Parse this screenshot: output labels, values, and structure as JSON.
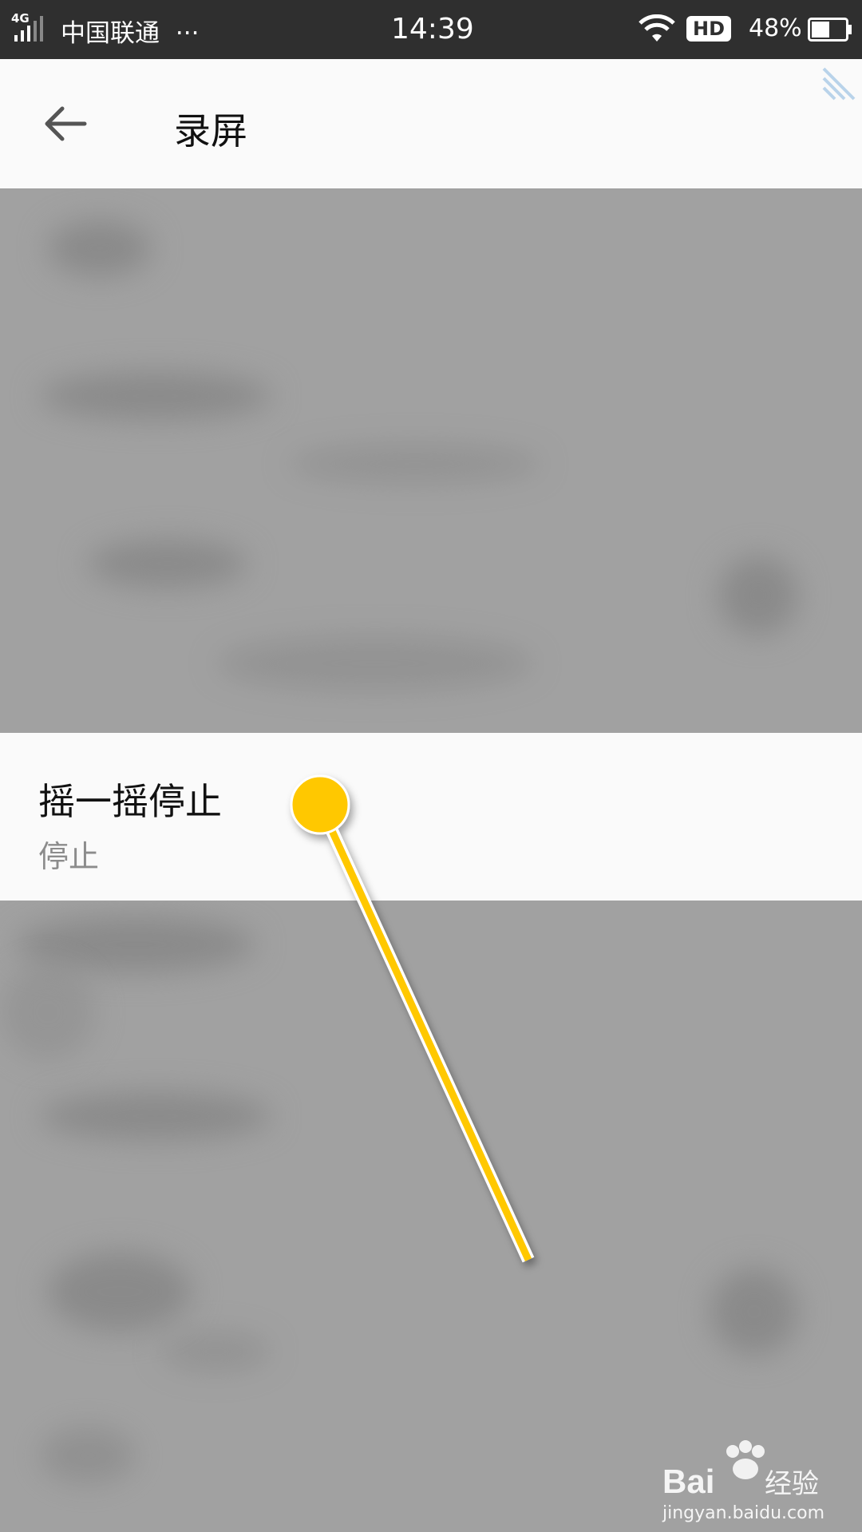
{
  "status_bar": {
    "network": "4G",
    "carrier": "中国联通",
    "overflow": "···",
    "time": "14:39",
    "hd": "HD",
    "battery": "48%"
  },
  "header": {
    "title": "录屏"
  },
  "setting": {
    "title": "摇一摇停止",
    "value": "停止"
  },
  "watermark": {
    "brand": "Baidu经验",
    "url": "jingyan.baidu.com"
  },
  "colors": {
    "status_bar_bg": "#2f2f2f",
    "header_bg": "#fafafa",
    "overlay": "#a1a1a1",
    "pointer": "#ffc800"
  },
  "icons": {
    "back": "arrow-left-icon",
    "wifi": "wifi-icon",
    "battery": "battery-icon",
    "signal": "signal-icon"
  }
}
